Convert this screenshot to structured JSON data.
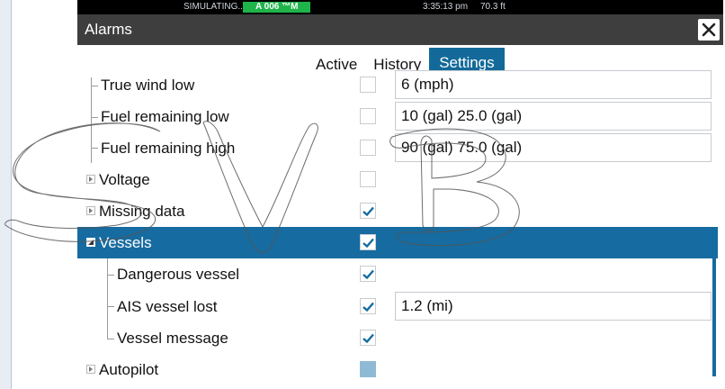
{
  "status": {
    "simulating": "SIMULATING...",
    "gps_badge": "A 006 ™M",
    "time": "3:35:13 pm",
    "depth": "70.3 ft"
  },
  "window": {
    "title": "Alarms",
    "close_icon": "close-icon"
  },
  "tabs": [
    {
      "label": "Active",
      "selected": false
    },
    {
      "label": "History",
      "selected": false
    },
    {
      "label": "Settings",
      "selected": true
    }
  ],
  "rows": [
    {
      "label": "True wind low",
      "checked": false,
      "value": "6 (mph)"
    },
    {
      "label": "Fuel remaining low",
      "checked": false,
      "value": "10 (gal)  25.0 (gal)"
    },
    {
      "label": "Fuel remaining high",
      "checked": false,
      "value": "90 (gal)  75.0 (gal)"
    },
    {
      "label": "Voltage",
      "checked": false,
      "value": ""
    },
    {
      "label": "Missing data",
      "checked": true,
      "value": ""
    },
    {
      "label": "Vessels",
      "checked": true,
      "value": "",
      "selected": true
    },
    {
      "label": "Dangerous vessel",
      "checked": true,
      "value": ""
    },
    {
      "label": "AIS vessel lost",
      "checked": true,
      "value": "1.2 (mi)"
    },
    {
      "label": "Vessel message",
      "checked": true,
      "value": ""
    },
    {
      "label": "Autopilot",
      "checked": "partial",
      "value": ""
    }
  ],
  "watermark": "SVB",
  "colors": {
    "accent": "#166ba0",
    "titlebar": "#3e3e3e",
    "gps_badge": "#1fb44a",
    "check": "#166ba0"
  }
}
